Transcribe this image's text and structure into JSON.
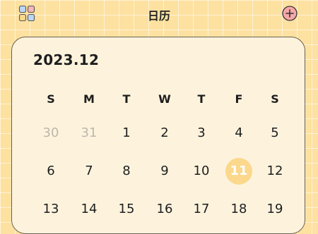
{
  "header": {
    "title": "日历"
  },
  "calendar": {
    "month_label": "2023.12",
    "weekdays": [
      "S",
      "M",
      "T",
      "W",
      "T",
      "F",
      "S"
    ],
    "weeks": [
      [
        {
          "d": "30",
          "muted": true
        },
        {
          "d": "31",
          "muted": true
        },
        {
          "d": "1"
        },
        {
          "d": "2"
        },
        {
          "d": "3"
        },
        {
          "d": "4"
        },
        {
          "d": "5"
        }
      ],
      [
        {
          "d": "6"
        },
        {
          "d": "7"
        },
        {
          "d": "8"
        },
        {
          "d": "9"
        },
        {
          "d": "10"
        },
        {
          "d": "11",
          "today": true
        },
        {
          "d": "12"
        }
      ],
      [
        {
          "d": "13"
        },
        {
          "d": "14"
        },
        {
          "d": "15"
        },
        {
          "d": "16"
        },
        {
          "d": "17"
        },
        {
          "d": "18"
        },
        {
          "d": "19"
        }
      ]
    ]
  },
  "colors": {
    "background": "#fde1a0",
    "card": "#fdf3dd",
    "today": "#fbd88c",
    "add_button": "#f7a7a7",
    "muted_text": "#bdb7ac"
  },
  "icons": {
    "apps": "grid-four-squares",
    "add": "plus-circle"
  }
}
